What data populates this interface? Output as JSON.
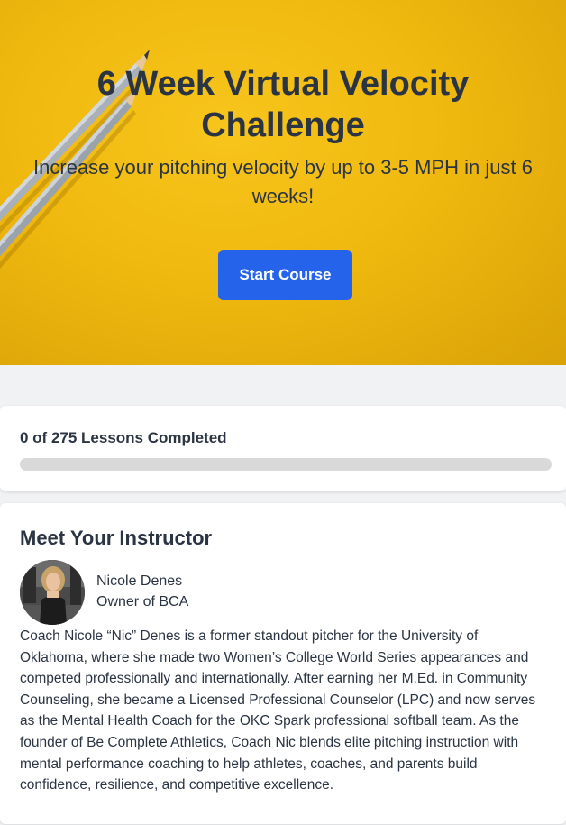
{
  "hero": {
    "title": "6 Week Virtual Velocity Challenge",
    "subtitle": "Increase your pitching velocity by up to 3-5 MPH in just 6 weeks!",
    "cta_label": "Start Course",
    "background_color": "#f0b90f",
    "cta_color": "#2563eb"
  },
  "progress": {
    "label": "0 of 275 Lessons Completed",
    "completed": 0,
    "total": 275,
    "fraction": 0
  },
  "instructor": {
    "section_title": "Meet Your Instructor",
    "name": "Nicole Denes",
    "role": "Owner of BCA",
    "bio": "Coach Nicole “Nic” Denes is a former standout pitcher for the University of Oklahoma, where she made two Women’s College World Series appearances and competed professionally and internationally. After earning her M.Ed. in Community Counseling, she became a Licensed Professional Counselor (LPC) and now serves as the Mental Health Coach for the OKC Spark professional softball team. As the founder of Be Complete Athletics, Coach Nic blends elite pitching instruction with mental performance coaching to help athletes, coaches, and parents build confidence, resilience, and competitive excellence."
  },
  "icons": {
    "hero_decoration": "pencils-image",
    "avatar": "instructor-photo"
  }
}
